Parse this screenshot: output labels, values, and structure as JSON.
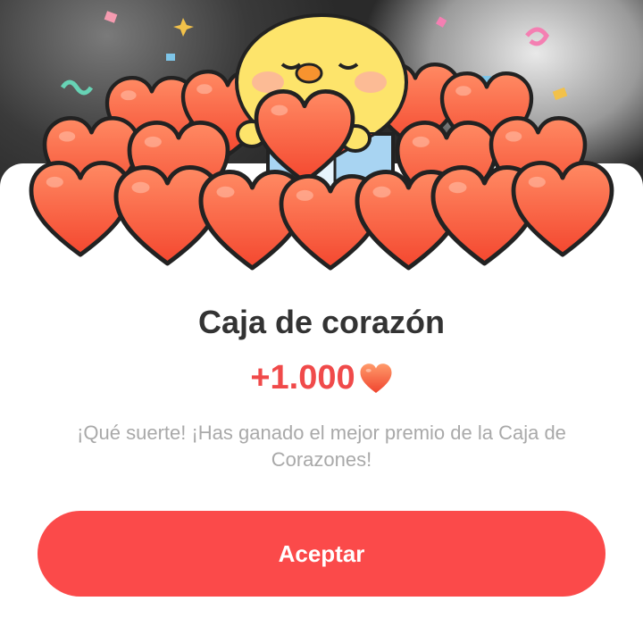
{
  "dialog": {
    "title": "Caja de corazón",
    "reward_amount": "+1.000",
    "reward_icon": "heart-icon",
    "message": "¡Qué suerte! ¡Has ganado el mejor premio de la Caja de Corazones!",
    "accept_label": "Aceptar"
  },
  "colors": {
    "accent": "#fb4a4a",
    "reward_text": "#f04a4a",
    "title_text": "#333333",
    "message_text": "#a9a9a9",
    "heart_fill": "#f9623f",
    "chick_fill": "#fde46b"
  }
}
